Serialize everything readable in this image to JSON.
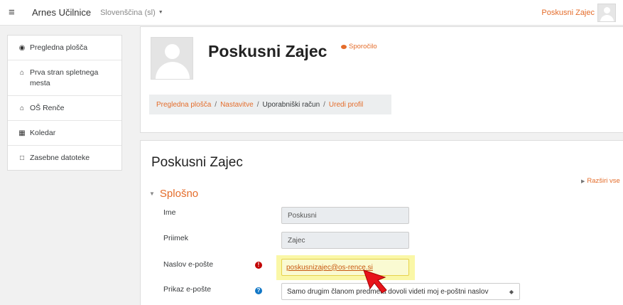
{
  "navbar": {
    "site_name": "Arnes Učilnice",
    "language": "Slovenščina (sl)",
    "user_name": "Poskusni Zajec"
  },
  "sidebar": {
    "items": [
      {
        "label": "Pregledna plošča",
        "icon": "dashboard-icon"
      },
      {
        "label": "Prva stran spletnega mesta",
        "icon": "home-icon"
      },
      {
        "label": "OŠ Renče",
        "icon": "home-icon"
      },
      {
        "label": "Koledar",
        "icon": "calendar-icon"
      },
      {
        "label": "Zasebne datoteke",
        "icon": "file-icon"
      }
    ]
  },
  "header": {
    "name": "Poskusni Zajec",
    "message_label": "Sporočilo",
    "breadcrumb": [
      {
        "label": "Pregledna plošča",
        "link": true
      },
      {
        "label": "Nastavitve",
        "link": true
      },
      {
        "label": "Uporabniški račun",
        "link": false
      },
      {
        "label": "Uredi profil",
        "link": true
      }
    ]
  },
  "form": {
    "title": "Poskusni Zajec",
    "expand_all": "Razširi vse",
    "section_title": "Splošno",
    "fields": {
      "first_name": {
        "label": "Ime",
        "value": "Poskusni"
      },
      "last_name": {
        "label": "Priimek",
        "value": "Zajec"
      },
      "email": {
        "label": "Naslov e-pošte",
        "value": "poskusnizajec@os-rence.si"
      },
      "email_display": {
        "label": "Prikaz e-pošte",
        "value": "Samo drugim članom predmeta dovoli videti moj e-poštni naslov"
      }
    }
  },
  "colors": {
    "accent": "#e46c2a",
    "required": "#c20000",
    "help": "#1177c6",
    "highlight": "#faf7a7",
    "cursor": "#e8141a"
  }
}
